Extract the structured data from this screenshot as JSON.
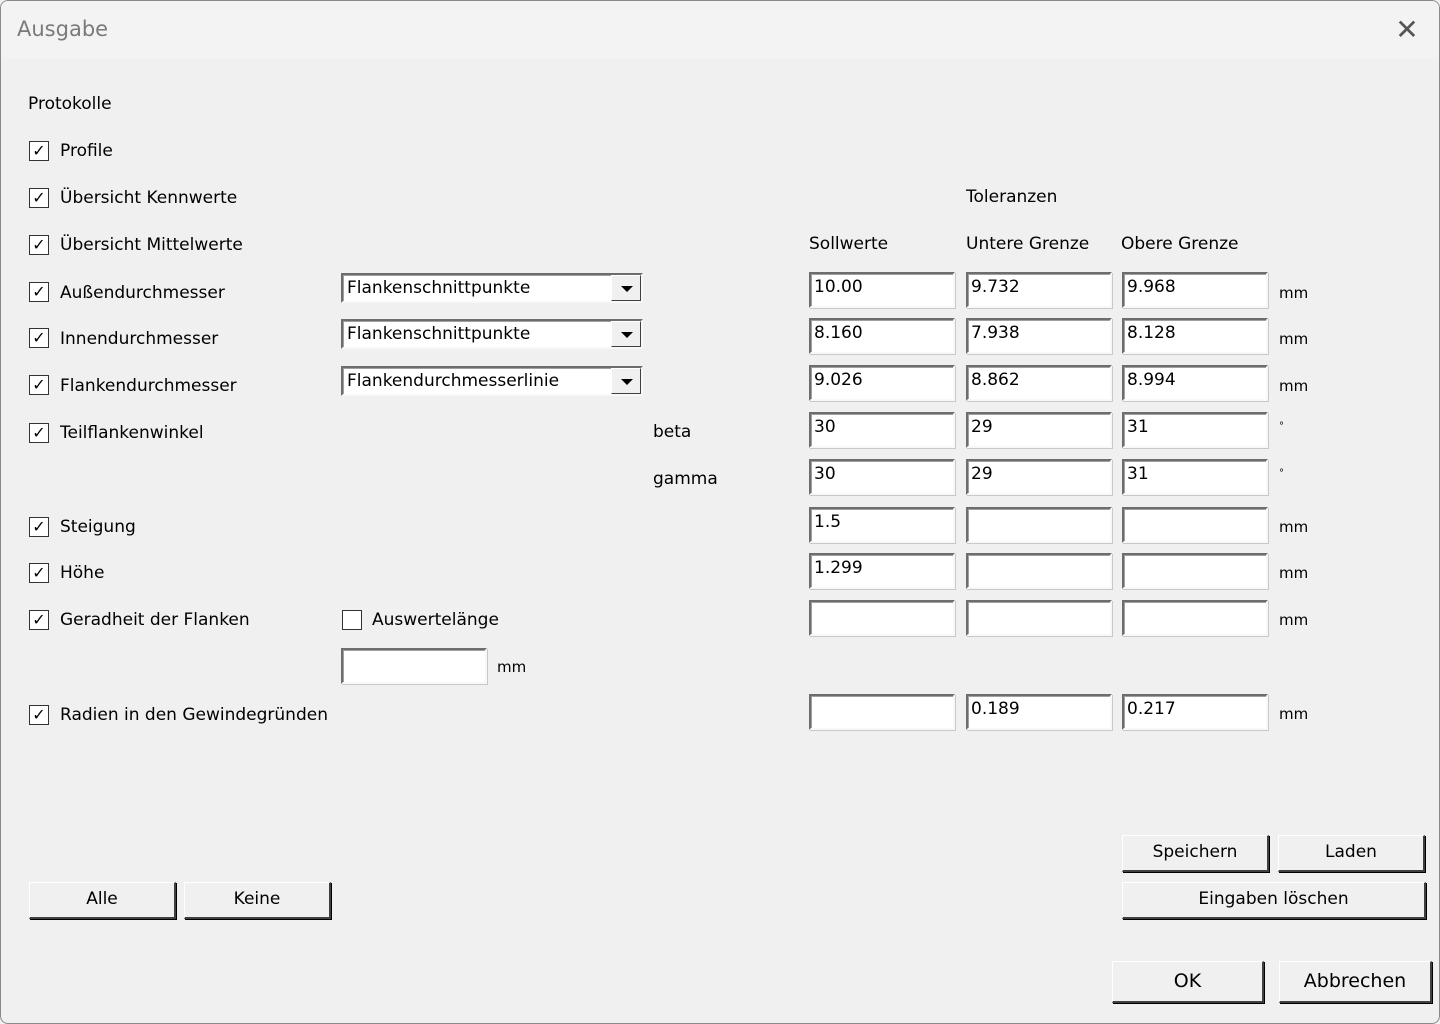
{
  "window": {
    "title": "Ausgabe",
    "close_label": "✕"
  },
  "section_title": "Protokolle",
  "checkboxes": [
    {
      "label": "Profile",
      "checked": true
    },
    {
      "label": "Übersicht Kennwerte",
      "checked": true
    },
    {
      "label": "Übersicht Mittelwerte",
      "checked": true
    },
    {
      "label": "Außendurchmesser",
      "checked": true
    },
    {
      "label": "Innendurchmesser",
      "checked": true
    },
    {
      "label": "Flankendurchmesser",
      "checked": true
    },
    {
      "label": "Teilflankenwinkel",
      "checked": true
    },
    {
      "label": "Steigung",
      "checked": true
    },
    {
      "label": "Höhe",
      "checked": true
    },
    {
      "label": "Geradheit der Flanken",
      "checked": true
    },
    {
      "label": "Radien in den Gewindegründen",
      "checked": true
    }
  ],
  "dropdowns": {
    "aussen": "Flankenschnittpunkte",
    "innen": "Flankenschnittpunkte",
    "flanken": "Flankendurchmesserlinie"
  },
  "auswertelaenge": {
    "label": "Auswertelänge",
    "checked": false,
    "value": "",
    "unit": "mm"
  },
  "sub_labels": {
    "beta": "beta",
    "gamma": "gamma"
  },
  "headers": {
    "tolerances": "Toleranzen",
    "nominal": "Sollwerte",
    "lower": "Untere Grenze",
    "upper": "Obere Grenze"
  },
  "rows": [
    {
      "nominal": "10.00",
      "lower": "9.732",
      "upper": "9.968",
      "unit": "mm"
    },
    {
      "nominal": "8.160",
      "lower": "7.938",
      "upper": "8.128",
      "unit": "mm"
    },
    {
      "nominal": "9.026",
      "lower": "8.862",
      "upper": "8.994",
      "unit": "mm"
    },
    {
      "nominal": "30",
      "lower": "29",
      "upper": "31",
      "unit": "°"
    },
    {
      "nominal": "30",
      "lower": "29",
      "upper": "31",
      "unit": "°"
    },
    {
      "nominal": "1.5",
      "lower": "",
      "upper": "",
      "unit": "mm"
    },
    {
      "nominal": "1.299",
      "lower": "",
      "upper": "",
      "unit": "mm"
    },
    {
      "nominal": "",
      "lower": "",
      "upper": "",
      "unit": "mm"
    },
    {
      "nominal": "",
      "lower": "0.189",
      "upper": "0.217",
      "unit": "mm"
    }
  ],
  "buttons": {
    "all": "Alle",
    "none": "Keine",
    "save": "Speichern",
    "load": "Laden",
    "clear": "Eingaben löschen",
    "ok": "OK",
    "cancel": "Abbrechen"
  }
}
